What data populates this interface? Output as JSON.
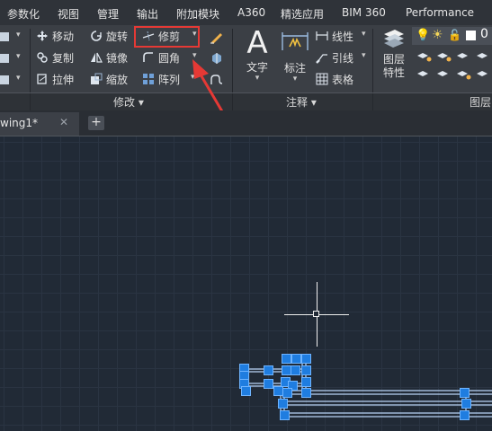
{
  "menu": [
    "参数化",
    "视图",
    "管理",
    "输出",
    "附加模块",
    "A360",
    "精选应用",
    "BIM 360",
    "Performance"
  ],
  "modify_panel": {
    "title": "修改",
    "tools": {
      "move": "移动",
      "rotate": "旋转",
      "trim": "修剪",
      "copy": "复制",
      "mirror": "镜像",
      "fillet": "圆角",
      "stretch": "拉伸",
      "scale": "缩放",
      "array": "阵列"
    }
  },
  "annotation_panel": {
    "title": "注释",
    "text": "文字",
    "dimension": "标注",
    "linear": "线性",
    "leader": "引线",
    "table": "表格"
  },
  "layers_panel": {
    "title": "图层",
    "layer_properties": [
      "图层",
      "特性"
    ]
  },
  "file_tab": {
    "label": "wing1*"
  },
  "colors": {
    "highlight": "#e53935",
    "grip": "#1f7de0",
    "canvas": "#212a36"
  }
}
